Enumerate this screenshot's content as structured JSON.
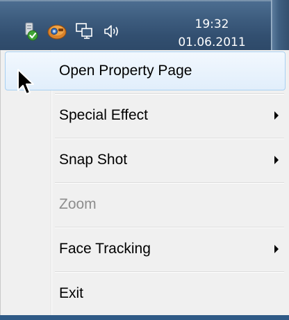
{
  "taskbar": {
    "clock_time": "19:32",
    "clock_date": "01.06.2011",
    "tray_icons": [
      "network-status-icon",
      "webcam-app-icon",
      "network-display-icon",
      "speaker-volume-icon"
    ]
  },
  "context_menu": {
    "items": [
      {
        "label": "Open Property Page",
        "state": "highlighted",
        "submenu": false
      },
      {
        "label": "Special Effect",
        "state": "enabled",
        "submenu": true
      },
      {
        "label": "Snap Shot",
        "state": "enabled",
        "submenu": true
      },
      {
        "label": "Zoom",
        "state": "disabled",
        "submenu": false
      },
      {
        "label": "Face Tracking",
        "state": "enabled",
        "submenu": true
      },
      {
        "label": "Exit",
        "state": "enabled",
        "submenu": false
      }
    ]
  },
  "colors": {
    "taskbar": "#3d5c7e",
    "menu_background": "#f0f0f0",
    "highlight_border": "#a8d0f2",
    "disabled_text": "#8d8d8d"
  }
}
